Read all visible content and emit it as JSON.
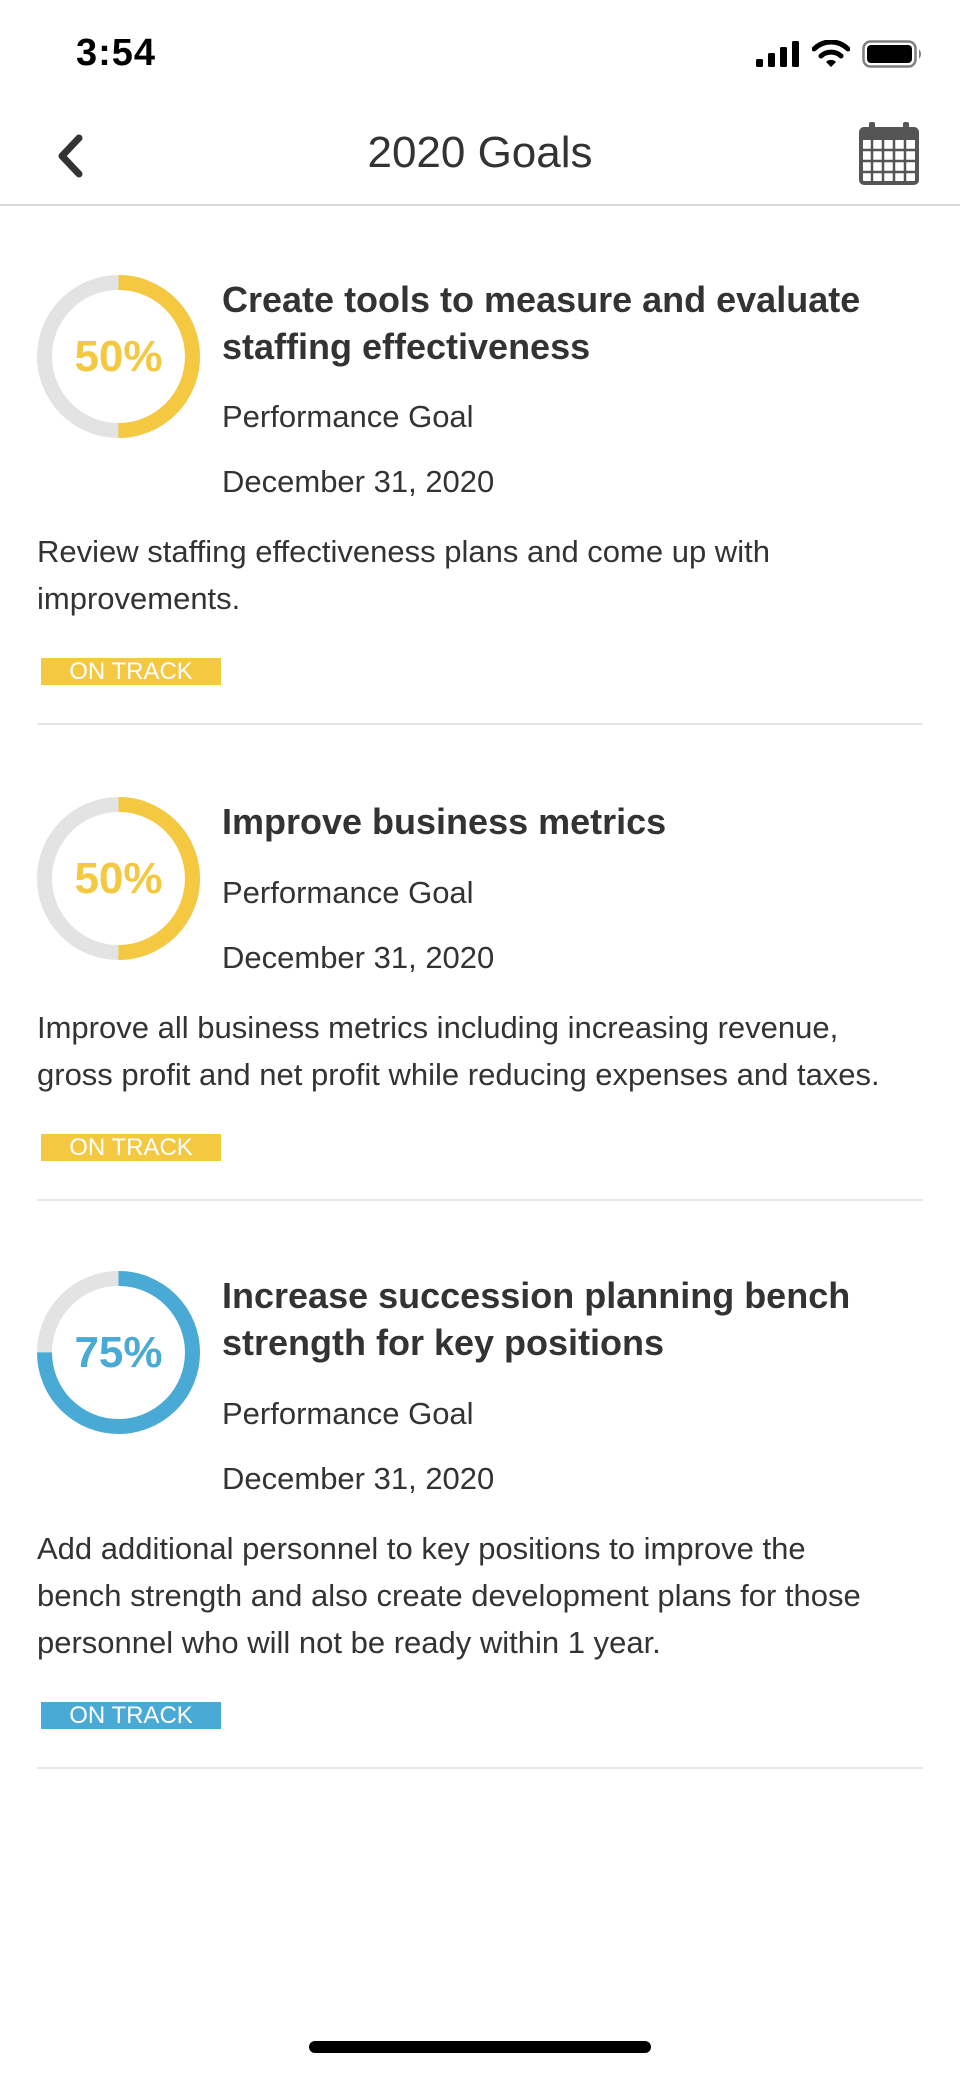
{
  "status_bar": {
    "time": "3:54",
    "icons": [
      "cellular-signal-icon",
      "wifi-icon",
      "battery-icon"
    ]
  },
  "header": {
    "title": "2020 Goals",
    "back_icon": "chevron-left-icon",
    "calendar_icon": "calendar-icon"
  },
  "colors": {
    "yellow": "#F5C842",
    "blue": "#4AAAD6",
    "track": "#E3E3E3"
  },
  "goals": [
    {
      "progress_label": "50%",
      "progress": 0.5,
      "color": "#F5C842",
      "title_lines": [
        "Create tools to measure and evaluate",
        "staffing effectiveness"
      ],
      "type": "Performance Goal",
      "due_date": "December 31, 2020",
      "description_lines": [
        "Review staffing effectiveness plans and come up with",
        "improvements."
      ],
      "status": "ON TRACK"
    },
    {
      "progress_label": "50%",
      "progress": 0.5,
      "color": "#F5C842",
      "title_lines": [
        "Improve business metrics"
      ],
      "type": "Performance Goal",
      "due_date": "December 31, 2020",
      "description_lines": [
        "Improve all business metrics including increasing revenue,",
        "gross profit and net profit while reducing expenses and taxes."
      ],
      "status": "ON TRACK"
    },
    {
      "progress_label": "75%",
      "progress": 0.75,
      "color": "#4AAAD6",
      "title_lines": [
        "Increase succession planning bench",
        "strength for key positions"
      ],
      "type": "Performance Goal",
      "due_date": "December 31, 2020",
      "description_lines": [
        "Add additional personnel to key positions to improve the",
        "bench strength and also create development plans for those",
        "personnel who will not be ready within 1 year."
      ],
      "status": "ON TRACK"
    }
  ]
}
